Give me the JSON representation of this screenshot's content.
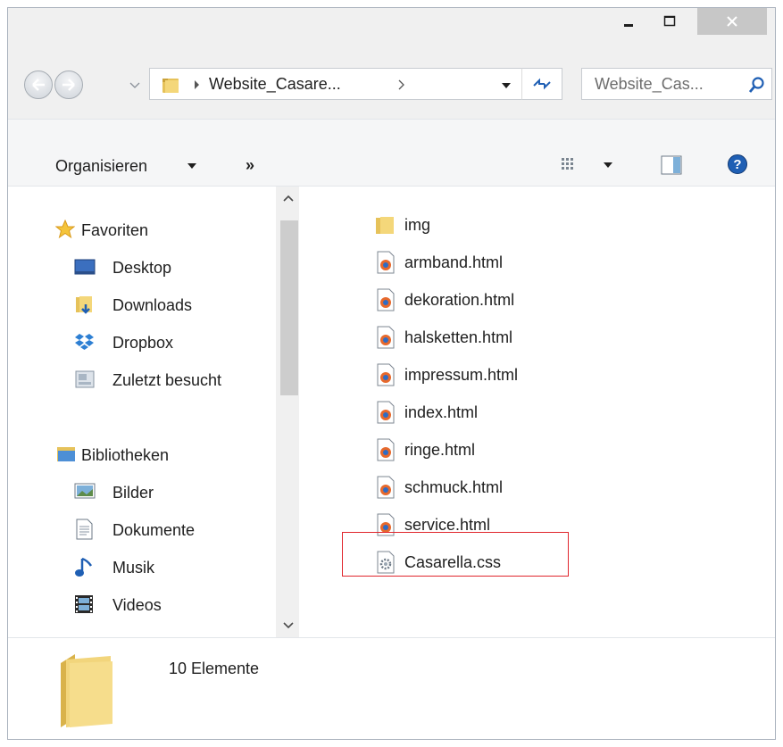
{
  "window": {
    "controls": {
      "minimize": "minimize",
      "maximize": "maximize",
      "close": "close"
    }
  },
  "address_bar": {
    "path_segment": "Website_Casare...",
    "search_placeholder": "Website_Cas..."
  },
  "toolbar": {
    "organize_label": "Organisieren",
    "more_label": "»"
  },
  "nav_pane": {
    "favorites": {
      "label": "Favoriten",
      "items": [
        {
          "label": "Desktop",
          "icon": "desktop-icon"
        },
        {
          "label": "Downloads",
          "icon": "downloads-icon"
        },
        {
          "label": "Dropbox",
          "icon": "dropbox-icon"
        },
        {
          "label": "Zuletzt besucht",
          "icon": "recent-places-icon"
        }
      ]
    },
    "libraries": {
      "label": "Bibliotheken",
      "items": [
        {
          "label": "Bilder",
          "icon": "pictures-icon"
        },
        {
          "label": "Dokumente",
          "icon": "documents-icon"
        },
        {
          "label": "Musik",
          "icon": "music-icon"
        },
        {
          "label": "Videos",
          "icon": "videos-icon"
        }
      ]
    }
  },
  "files": [
    {
      "name": "img",
      "type": "folder"
    },
    {
      "name": "armband.html",
      "type": "html"
    },
    {
      "name": "dekoration.html",
      "type": "html"
    },
    {
      "name": "halsketten.html",
      "type": "html"
    },
    {
      "name": "impressum.html",
      "type": "html"
    },
    {
      "name": "index.html",
      "type": "html"
    },
    {
      "name": "ringe.html",
      "type": "html"
    },
    {
      "name": "schmuck.html",
      "type": "html"
    },
    {
      "name": "service.html",
      "type": "html"
    },
    {
      "name": "Casarella.css",
      "type": "css",
      "highlighted": true
    }
  ],
  "status": {
    "count_label": "10 Elemente"
  },
  "colors": {
    "highlight_border": "#e0262c",
    "close_button": "#c7c7c7",
    "help_icon": "#1f5fb4"
  }
}
